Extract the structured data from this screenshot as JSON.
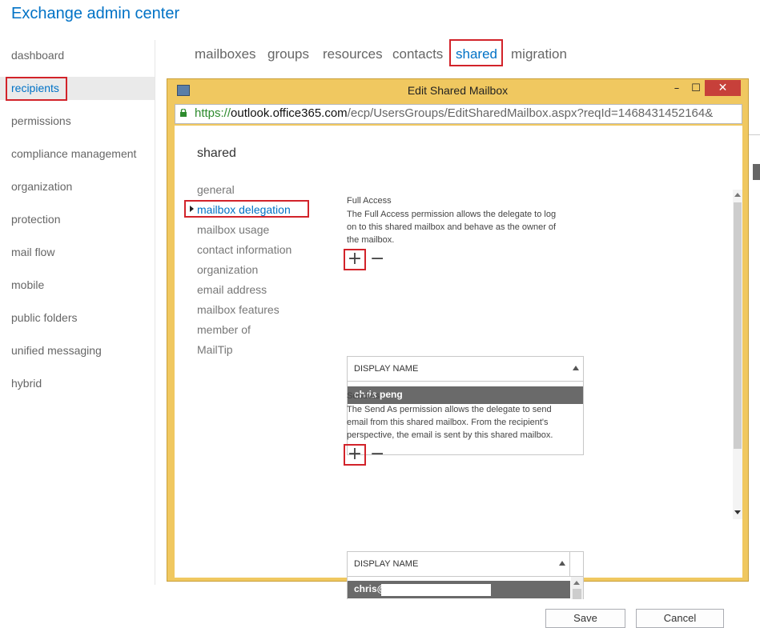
{
  "app": {
    "title": "Exchange admin center"
  },
  "leftnav": {
    "items": [
      {
        "label": "dashboard"
      },
      {
        "label": "recipients"
      },
      {
        "label": "permissions"
      },
      {
        "label": "compliance management"
      },
      {
        "label": "organization"
      },
      {
        "label": "protection"
      },
      {
        "label": "mail flow"
      },
      {
        "label": "mobile"
      },
      {
        "label": "public folders"
      },
      {
        "label": "unified messaging"
      },
      {
        "label": "hybrid"
      }
    ],
    "selected": "recipients"
  },
  "tabs": {
    "items": [
      {
        "label": "mailboxes"
      },
      {
        "label": "groups"
      },
      {
        "label": "resources"
      },
      {
        "label": "contacts"
      },
      {
        "label": "shared"
      },
      {
        "label": "migration"
      }
    ],
    "selected": "shared"
  },
  "dialog": {
    "title": "Edit Shared Mailbox",
    "window_buttons": {
      "minimize": "–",
      "maximize": "☐",
      "close": "✕"
    },
    "url": {
      "protocol": "https://",
      "host": "outlook.office365.com",
      "path": "/ecp/UsersGroups/EditSharedMailbox.aspx?reqId=1468431452164&"
    },
    "section_title": "shared",
    "subnav": [
      {
        "label": "general"
      },
      {
        "label": "mailbox delegation"
      },
      {
        "label": "mailbox usage"
      },
      {
        "label": "contact information"
      },
      {
        "label": "organization"
      },
      {
        "label": "email address"
      },
      {
        "label": "mailbox features"
      },
      {
        "label": "member of"
      },
      {
        "label": "MailTip"
      }
    ],
    "subnav_selected": "mailbox delegation",
    "full_access": {
      "heading": "Full Access",
      "description_lines": [
        "The Full Access permission allows the delegate to log",
        "on to this shared mailbox and behave as the owner of",
        "the mailbox."
      ],
      "add_icon": "+",
      "remove_icon": "−",
      "column_header": "DISPLAY NAME",
      "rows": [
        "chris peng"
      ]
    },
    "send_as": {
      "heading": "Send As",
      "description_lines": [
        "The Send As permission allows the delegate to send",
        "email from this shared mailbox. From the recipient's",
        "perspective, the email is sent by this shared mailbox."
      ],
      "add_icon": "+",
      "remove_icon": "−",
      "column_header": "DISPLAY NAME",
      "rows": [
        "chris@"
      ]
    },
    "buttons": {
      "save": "Save",
      "cancel": "Cancel"
    }
  },
  "colors": {
    "accent": "#0072c6",
    "highlight_box": "#d2232a",
    "dialog_frame": "#f0c860",
    "close_button": "#c7403a",
    "selected_row": "#6a6a6a"
  }
}
